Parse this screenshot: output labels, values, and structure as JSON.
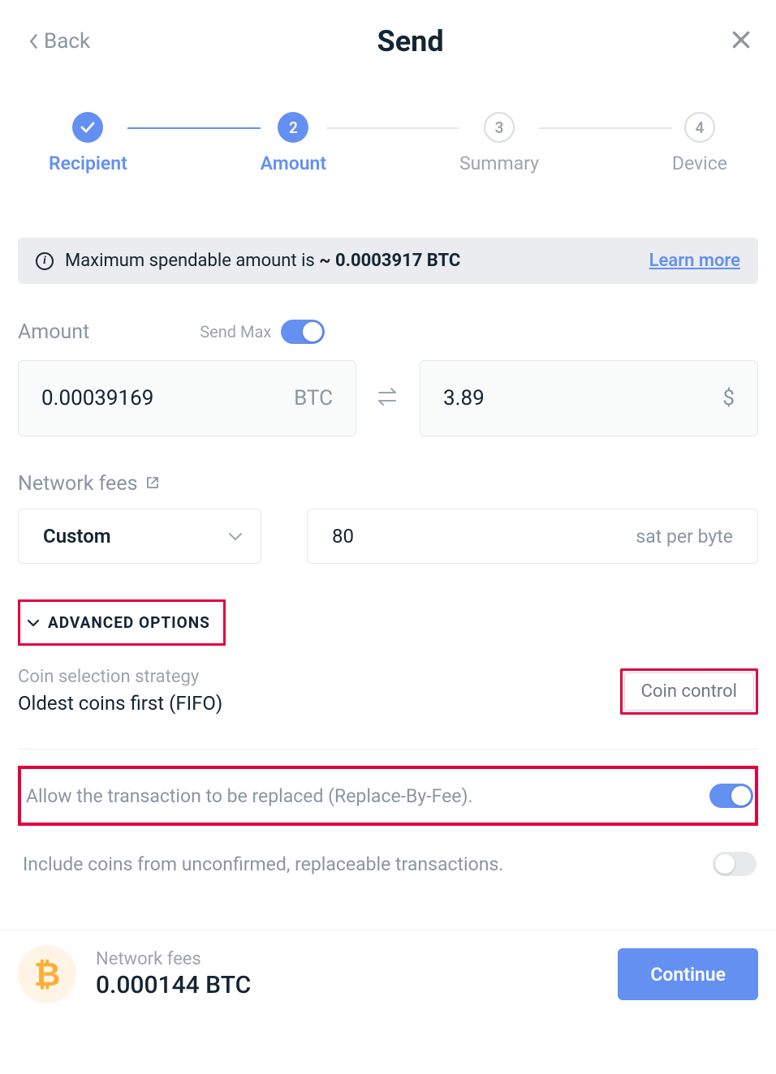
{
  "header": {
    "back": "Back",
    "title": "Send"
  },
  "steps": {
    "recipient": "Recipient",
    "amount": "Amount",
    "summary": "Summary",
    "device": "Device",
    "n2": "2",
    "n3": "3",
    "n4": "4"
  },
  "banner": {
    "prefix": "Maximum spendable amount is ",
    "approx": "~",
    "value": " 0.0003917 BTC",
    "learn": "Learn more"
  },
  "amount": {
    "label": "Amount",
    "sendmax": "Send Max",
    "crypto_value": "0.00039169",
    "crypto_unit": "BTC",
    "fiat_value": "3.89",
    "fiat_unit": "$"
  },
  "fees": {
    "label": "Network fees",
    "mode": "Custom",
    "rate": "80",
    "unit": "sat per byte"
  },
  "advanced": {
    "toggle": "ADVANCED OPTIONS",
    "strategy_label": "Coin selection strategy",
    "strategy_value": "Oldest coins first (FIFO)",
    "coin_control": "Coin control",
    "rbf": "Allow the transaction to be replaced (Replace-By-Fee).",
    "unconfirmed": "Include coins from unconfirmed, replaceable transactions."
  },
  "footer": {
    "fees_label": "Network fees",
    "fees_value": "0.000144 BTC",
    "continue": "Continue"
  }
}
